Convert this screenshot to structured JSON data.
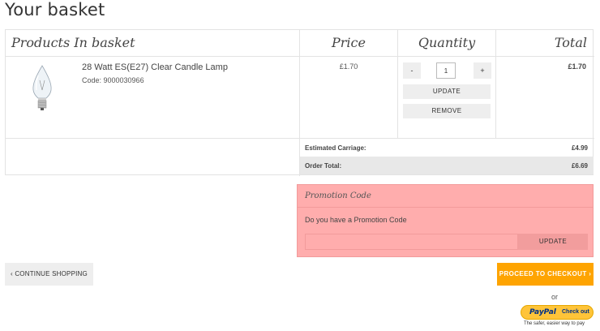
{
  "page": {
    "title": "Your basket"
  },
  "table": {
    "headers": {
      "products": "Products In basket",
      "price": "Price",
      "quantity": "Quantity",
      "total": "Total"
    },
    "items": [
      {
        "name": "28 Watt ES(E27) Clear Candle Lamp",
        "code": "Code: 9000030966",
        "price": "£1.70",
        "quantity": "1",
        "total": "£1.70",
        "image_icon": "candle-lamp-bulb-image"
      }
    ],
    "qty_controls": {
      "minus": "-",
      "plus": "+",
      "update": "UPDATE",
      "remove": "REMOVE"
    }
  },
  "summary": {
    "carriage_label": "Estimated Carriage:",
    "carriage_value": "£4.99",
    "order_total_label": "Order Total:",
    "order_total_value": "£6.69"
  },
  "promo": {
    "title": "Promotion Code",
    "question": "Do you have a Promotion Code",
    "input_value": "",
    "button": "UPDATE"
  },
  "actions": {
    "continue": "‹ CONTINUE SHOPPING",
    "checkout": "PROCEED TO CHECKOUT ›",
    "or": "or"
  },
  "paypal": {
    "logo_pay": "PayPal",
    "logo_pal": "",
    "cta": "Check out",
    "tagline": "The safer, easier way to pay"
  },
  "colors": {
    "promo_bg": "#ffadad",
    "checkout_bg": "#fea401",
    "paypal_bg": "#ffc439",
    "grey_btn": "#eeeeee"
  }
}
